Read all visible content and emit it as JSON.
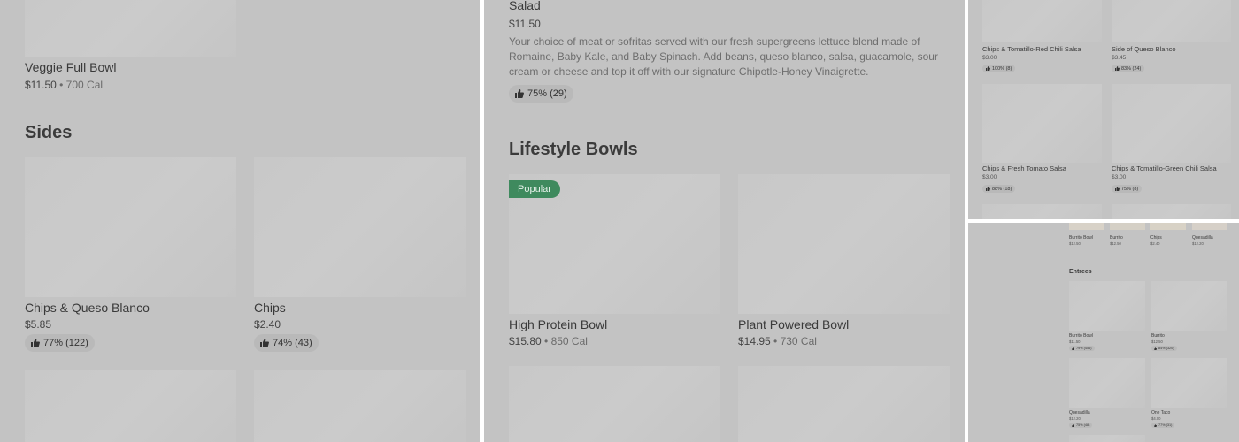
{
  "panel1": {
    "top_item": {
      "title": "Veggie Full Bowl",
      "price": "$11.50",
      "cal": " • 700 Cal"
    },
    "sides_heading": "Sides",
    "items": [
      {
        "title": "Chips & Queso Blanco",
        "price": "$5.85",
        "rating": "77% (122)"
      },
      {
        "title": "Chips",
        "price": "$2.40",
        "rating": "74% (43)"
      }
    ]
  },
  "panel2": {
    "top_item": {
      "title": "Salad",
      "price": "$11.50",
      "description": "Your choice of meat or sofritas served with our fresh supergreens lettuce blend made of Romaine, Baby Kale, and Baby Spinach. Add beans, queso blanco, salsa, guacamole, sour cream or cheese and top it off with our signature Chipotle-Honey Vinaigrette.",
      "rating": "75% (29)"
    },
    "heading": "Lifestyle Bowls",
    "popular_badge": "Popular",
    "items": [
      {
        "title": "High Protein Bowl",
        "price": "$15.80",
        "cal": " • 850 Cal"
      },
      {
        "title": "Plant Powered Bowl",
        "price": "$14.95",
        "cal": " • 730 Cal"
      }
    ]
  },
  "panel3": {
    "items": [
      {
        "title": "Chips & Tomatillo-Red Chili Salsa",
        "price": "$3.00",
        "rating": "100% (8)"
      },
      {
        "title": "Side of Queso Blanco",
        "price": "$3.45",
        "rating": "83% (24)"
      },
      {
        "title": "Chips & Fresh Tomato Salsa",
        "price": "$3.00",
        "rating": "88% (18)"
      },
      {
        "title": "Chips & Tomatillo-Green Chili Salsa",
        "price": "$3.00",
        "rating": "75% (8)"
      }
    ]
  },
  "panel4": {
    "top_strip": [
      {
        "title": "Burrito Bowl",
        "price": "$12.50"
      },
      {
        "title": "Burrito",
        "price": "$12.50"
      },
      {
        "title": "Chips",
        "price": "$2.40"
      },
      {
        "title": "Quesadilla",
        "price": "$12.20"
      }
    ],
    "heading": "Entrees",
    "items": [
      {
        "title": "Burrito Bowl",
        "price": "$11.50",
        "rating": "79% (456)"
      },
      {
        "title": "Burrito",
        "price": "$12.50",
        "rating": "84% (320)"
      },
      {
        "title": "Quesadilla",
        "price": "$12.20",
        "rating": "75% (48)"
      },
      {
        "title": "One Taco",
        "price": "$4.00",
        "rating": "77% (31)"
      }
    ]
  }
}
